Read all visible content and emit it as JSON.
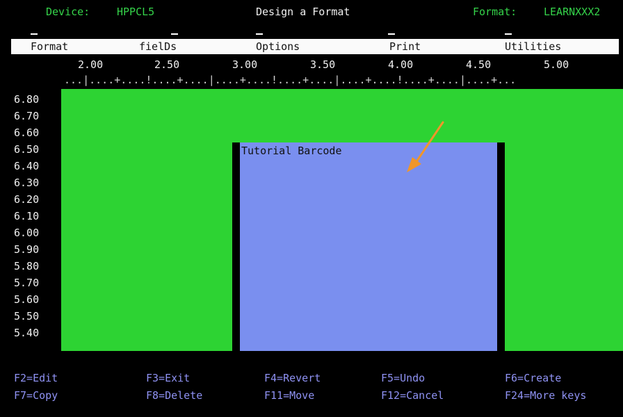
{
  "header": {
    "device_label": "Device:",
    "device_value": "HPPCL5",
    "title": "Design a Format",
    "format_label": "Format:",
    "format_value": "LEARNXXX2"
  },
  "menu": {
    "items": [
      "Format",
      "fielDs",
      "Options",
      "Print",
      "Utilities"
    ]
  },
  "ruler": {
    "numbers": [
      "2.00",
      "2.50",
      "3.00",
      "3.50",
      "4.00",
      "4.50",
      "5.00"
    ],
    "line": "...|....+....!....+....|....+....!....+....|....+....!....+....|....+..."
  },
  "y_axis": [
    "6.80",
    "6.70",
    "6.60",
    "6.50",
    "6.40",
    "6.30",
    "6.20",
    "6.10",
    "6.00",
    "5.90",
    "5.80",
    "5.70",
    "5.60",
    "5.50",
    "5.40"
  ],
  "barcode": {
    "label": "Tutorial Barcode",
    "color": "#7a8fef"
  },
  "design_area_color": "#2dd333",
  "arrow_color": "#f0962a",
  "function_keys": {
    "row1": [
      "F2=Edit",
      "F3=Exit",
      "F4=Revert",
      "F5=Undo",
      "F6=Create"
    ],
    "row2": [
      "F7=Copy",
      "F8=Delete",
      "F11=Move",
      "F12=Cancel",
      "F24=More keys"
    ]
  }
}
